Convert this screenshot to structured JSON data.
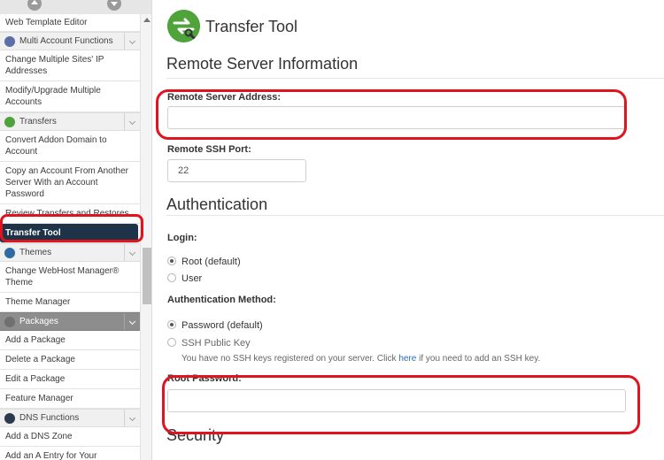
{
  "sidebar": {
    "items": [
      {
        "type": "item",
        "label": "Web Template Editor",
        "first": true
      },
      {
        "type": "cat",
        "label": "Multi Account Functions",
        "icon": "multi-account-icon"
      },
      {
        "type": "item",
        "label": "Change Multiple Sites' IP Addresses"
      },
      {
        "type": "item",
        "label": "Modify/Upgrade Multiple Accounts"
      },
      {
        "type": "cat",
        "label": "Transfers",
        "icon": "transfers-icon"
      },
      {
        "type": "item",
        "label": "Convert Addon Domain to Account"
      },
      {
        "type": "item",
        "label": "Copy an Account From Another Server With an Account Password"
      },
      {
        "type": "item",
        "label": "Review Transfers and Restores"
      },
      {
        "type": "item",
        "label": "Transfer Tool",
        "active": true
      },
      {
        "type": "cat",
        "label": "Themes",
        "icon": "themes-icon"
      },
      {
        "type": "item",
        "label": "Change WebHost Manager® Theme"
      },
      {
        "type": "item",
        "label": "Theme Manager"
      },
      {
        "type": "cat",
        "label": "Packages",
        "icon": "packages-icon",
        "dark": true
      },
      {
        "type": "item",
        "label": "Add a Package"
      },
      {
        "type": "item",
        "label": "Delete a Package"
      },
      {
        "type": "item",
        "label": "Edit a Package"
      },
      {
        "type": "item",
        "label": "Feature Manager"
      },
      {
        "type": "cat",
        "label": "DNS Functions",
        "icon": "dns-icon"
      },
      {
        "type": "item",
        "label": "Add a DNS Zone"
      },
      {
        "type": "item",
        "label": "Add an A Entry for Your"
      }
    ]
  },
  "main": {
    "title": "Transfer Tool",
    "remote": {
      "heading": "Remote Server Information",
      "address_label": "Remote Server Address:",
      "address_value": "",
      "port_label": "Remote SSH Port:",
      "port_value": "22"
    },
    "auth": {
      "heading": "Authentication",
      "login_label": "Login:",
      "login_options": [
        "Root (default)",
        "User"
      ],
      "login_selected": 0,
      "method_label": "Authentication Method:",
      "method_options": [
        "Password (default)",
        "SSH Public Key"
      ],
      "method_selected": 0,
      "ssh_note_prefix": "You have no SSH keys registered on your server. Click ",
      "ssh_note_link": "here",
      "ssh_note_suffix": " if you need to add an SSH key.",
      "password_label": "Root Password:",
      "password_value": ""
    },
    "security_heading": "Security"
  },
  "colors": {
    "highlight": "#e0141f",
    "active_item_bg": "#1f3348",
    "logo_green": "#4ea33a",
    "link": "#2a6dc3"
  }
}
